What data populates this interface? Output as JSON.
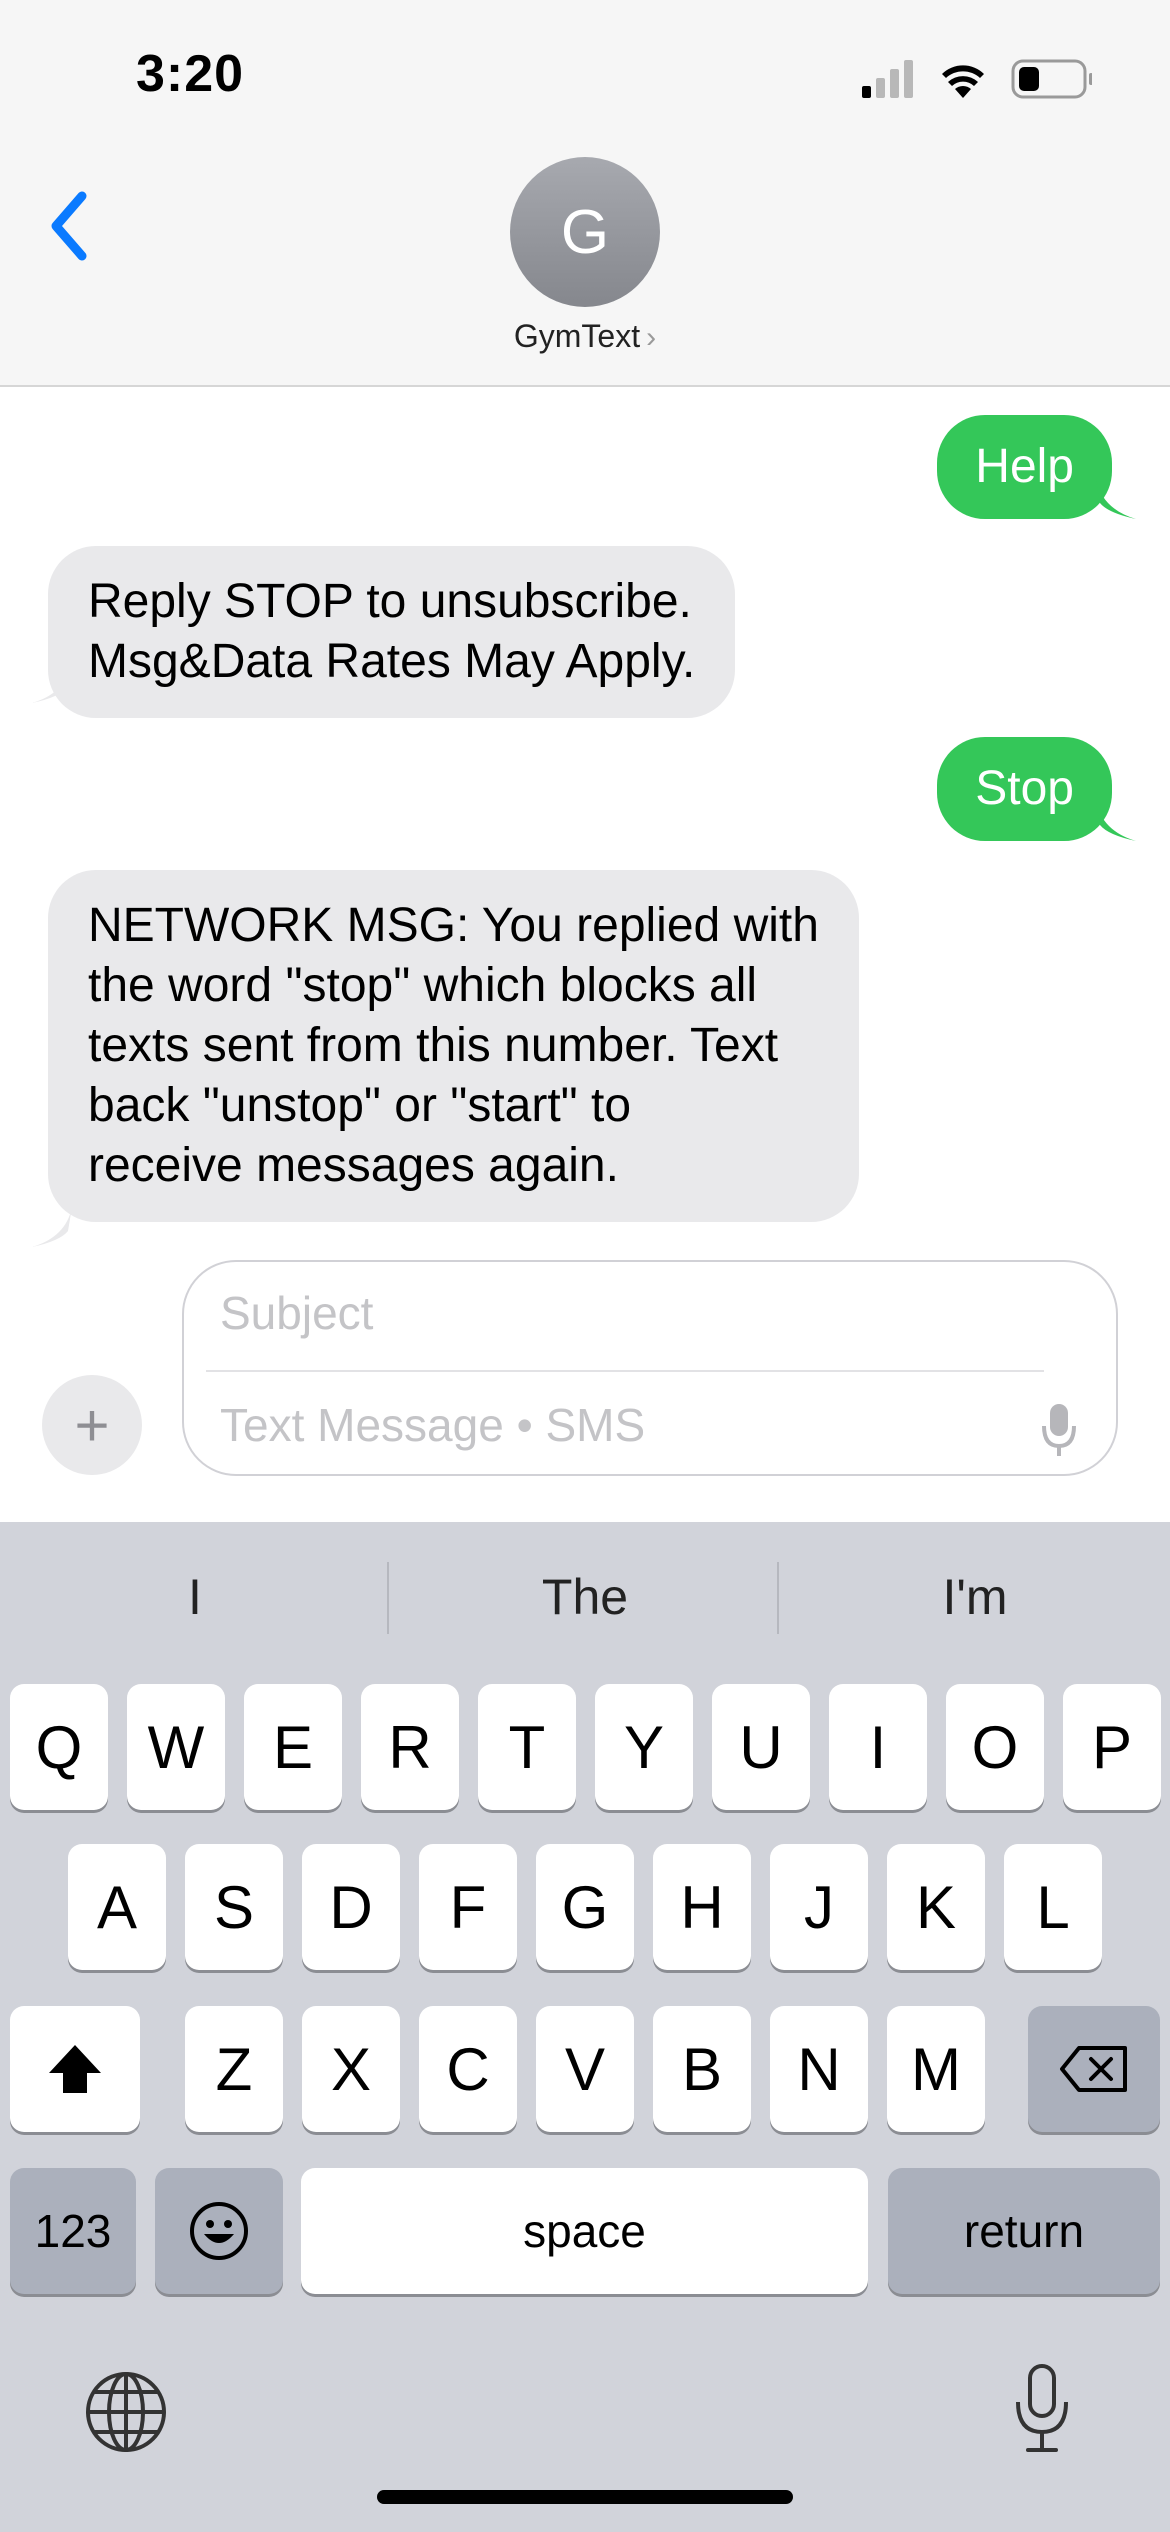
{
  "status_bar": {
    "time": "3:20"
  },
  "header": {
    "avatar_initial": "G",
    "contact_name": "GymText"
  },
  "messages": [
    {
      "direction": "outgoing",
      "text": "Help"
    },
    {
      "direction": "incoming",
      "lines": [
        "Reply STOP to unsubscribe.",
        "Msg&Data Rates May Apply."
      ]
    },
    {
      "direction": "outgoing",
      "text": "Stop"
    },
    {
      "direction": "incoming",
      "lines": [
        "NETWORK MSG: You replied with",
        "the word \"stop\" which blocks all",
        "texts sent from this number. Text",
        "back \"unstop\" or \"start\" to",
        "receive messages again."
      ]
    }
  ],
  "compose": {
    "plus_label": "+",
    "subject_placeholder": "Subject",
    "message_placeholder": "Text Message • SMS"
  },
  "keyboard": {
    "suggestions": [
      "I",
      "The",
      "I'm"
    ],
    "row1": [
      "Q",
      "W",
      "E",
      "R",
      "T",
      "Y",
      "U",
      "I",
      "O",
      "P"
    ],
    "row2": [
      "A",
      "S",
      "D",
      "F",
      "G",
      "H",
      "J",
      "K",
      "L"
    ],
    "row3": [
      "Z",
      "X",
      "C",
      "V",
      "B",
      "N",
      "M"
    ],
    "numbers_label": "123",
    "space_label": "space",
    "return_label": "return",
    "icons": [
      "shift-icon",
      "delete-icon",
      "emoji-icon",
      "globe-icon",
      "dictation-mic-icon"
    ]
  },
  "colors": {
    "outgoing_bubble": "#34c759",
    "incoming_bubble": "#e9e9eb",
    "accent": "#0a7aff"
  }
}
